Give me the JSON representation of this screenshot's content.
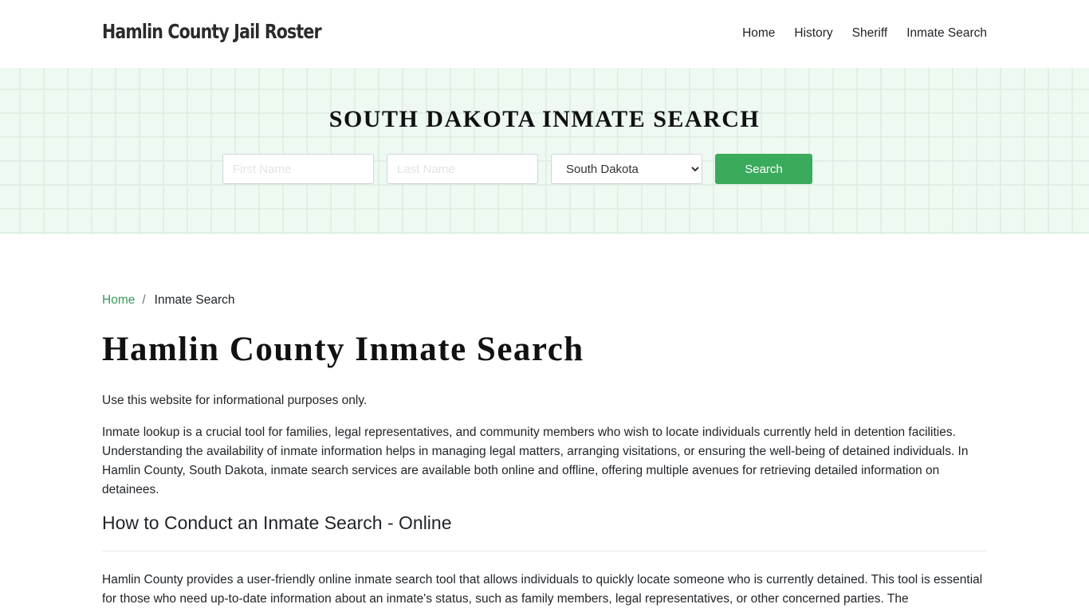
{
  "header": {
    "brand": "Hamlin County Jail Roster",
    "nav": [
      {
        "label": "Home"
      },
      {
        "label": "History"
      },
      {
        "label": "Sheriff"
      },
      {
        "label": "Inmate Search"
      }
    ]
  },
  "hero": {
    "title": "SOUTH DAKOTA INMATE SEARCH",
    "first_name_placeholder": "First Name",
    "last_name_placeholder": "Last Name",
    "state_selected": "South Dakota",
    "search_label": "Search",
    "accent_color": "#3aaa5c"
  },
  "breadcrumb": {
    "home": "Home",
    "separator": "/",
    "current": "Inmate Search"
  },
  "main": {
    "title": "Hamlin County Inmate Search",
    "disclaimer": "Use this website for informational purposes only.",
    "intro": "Inmate lookup is a crucial tool for families, legal representatives, and community members who wish to locate individuals currently held in detention facilities. Understanding the availability of inmate information helps in managing legal matters, arranging visitations, or ensuring the well-being of detained individuals. In Hamlin County, South Dakota, inmate search services are available both online and offline, offering multiple avenues for retrieving detailed information on detainees.",
    "section_heading": "How to Conduct an Inmate Search - Online",
    "section_text": "Hamlin County provides a user-friendly online inmate search tool that allows individuals to quickly locate someone who is currently detained. This tool is essential for those who need up-to-date information about an inmate's status, such as family members, legal representatives, or other concerned parties. The"
  }
}
